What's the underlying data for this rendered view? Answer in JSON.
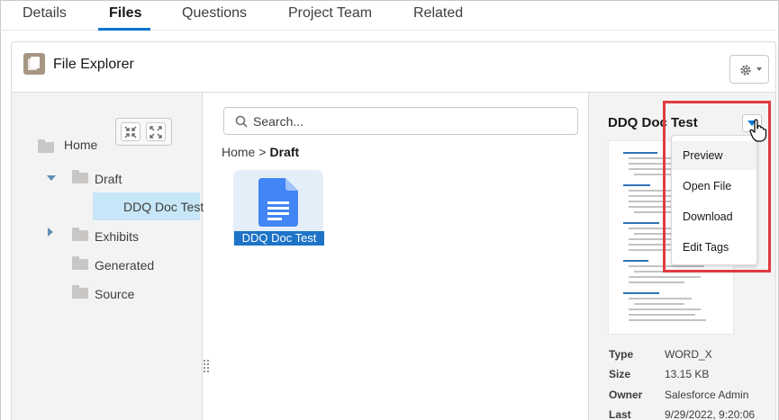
{
  "tabs": [
    {
      "label": "Details",
      "active": false
    },
    {
      "label": "Files",
      "active": true
    },
    {
      "label": "Questions",
      "active": false
    },
    {
      "label": "Project Team",
      "active": false
    },
    {
      "label": "Related",
      "active": false
    }
  ],
  "card": {
    "title": "File Explorer",
    "icon": "files-icon",
    "settings_icon": "gear-icon"
  },
  "tree": {
    "controls": [
      "collapse-all-icon",
      "expand-all-icon"
    ],
    "nodes": [
      {
        "label": "Home",
        "expanded": true
      },
      {
        "label": "Draft",
        "expanded": true
      },
      {
        "label": "DDQ Doc Test",
        "selected": true
      },
      {
        "label": "Exhibits",
        "expanded": false
      },
      {
        "label": "Generated"
      },
      {
        "label": "Source"
      }
    ]
  },
  "main": {
    "search_placeholder": "Search...",
    "breadcrumb": {
      "home": "Home",
      "separator": ">",
      "current": "Draft"
    },
    "files": [
      {
        "label": "DDQ Doc Test",
        "icon": "google-doc-icon",
        "selected": true
      }
    ]
  },
  "preview": {
    "title": "DDQ Doc Test",
    "meta": [
      {
        "key": "Type",
        "value": "WORD_X"
      },
      {
        "key": "Size",
        "value": "13.15 KB"
      },
      {
        "key": "Owner",
        "value": "Salesforce Admin"
      },
      {
        "key": "Last",
        "value": "9/29/2022, 9:20:06"
      }
    ]
  },
  "menu": {
    "items": [
      {
        "label": "Preview",
        "hovered": true
      },
      {
        "label": "Open File",
        "hovered": false
      },
      {
        "label": "Download",
        "hovered": false
      },
      {
        "label": "Edit Tags",
        "hovered": false
      }
    ]
  },
  "colors": {
    "accent": "#0176d3",
    "selected_node": "#c7e6f7",
    "file_label_bg": "#1d73c6",
    "highlight": "#e03a3e",
    "doc_blue": "#4285f4"
  }
}
